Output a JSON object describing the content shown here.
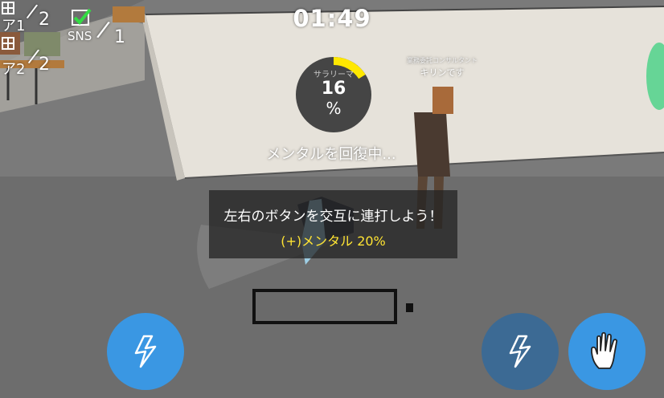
{
  "timer": "01:49",
  "counters": [
    {
      "label": "ア1",
      "value": "2",
      "icon": "area-icon"
    },
    {
      "label": "SNS",
      "value": "1",
      "icon": "check-icon"
    },
    {
      "label": "ア2",
      "value": "2",
      "icon": "area-icon"
    }
  ],
  "gauge": {
    "label": "サラリーマ",
    "value": "16",
    "unit": "%",
    "fraction": 0.16,
    "color": "#ffe800"
  },
  "status_text": "メンタルを回復中...",
  "npc": {
    "title": "業務委託コンサルタント",
    "name": "キリンです"
  },
  "instruction": {
    "main": "左右のボタンを交互に連打しよう！",
    "sub": "(+)メンタル 20%"
  },
  "battery_level": 0,
  "buttons": {
    "left_icon": "lightning-icon",
    "right_icon": "lightning-icon",
    "action_icon": "hand-icon"
  },
  "colors": {
    "button_active": "#3a97e3",
    "button_inactive": "#3c6a94",
    "highlight": "#ffe433"
  }
}
